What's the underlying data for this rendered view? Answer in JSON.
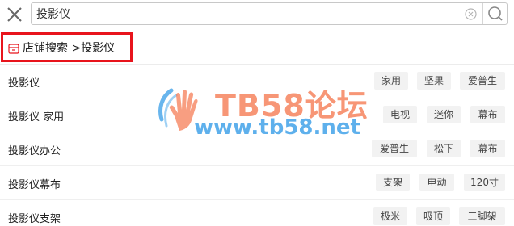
{
  "search": {
    "value": "投影仪"
  },
  "shop_search": {
    "label": "店铺搜索 >投影仪"
  },
  "suggestions": [
    {
      "text": "投影仪",
      "tags": [
        "家用",
        "坚果",
        "爱普生"
      ]
    },
    {
      "text": "投影仪 家用",
      "tags": [
        "电视",
        "迷你",
        "幕布"
      ]
    },
    {
      "text": "投影仪办公",
      "tags": [
        "爱普生",
        "松下",
        "幕布"
      ]
    },
    {
      "text": "投影仪幕布",
      "tags": [
        "支架",
        "电动",
        "120寸"
      ]
    },
    {
      "text": "投影仪支架",
      "tags": [
        "极米",
        "吸顶",
        "三脚架"
      ]
    }
  ],
  "watermark": {
    "title": "TB58论坛",
    "url": "www.tb58.net"
  },
  "colors": {
    "highlight_border": "#e8141c",
    "tag_bg": "#f2f2f2",
    "watermark_orange": "#f5784f",
    "watermark_blue": "#2896e6"
  }
}
